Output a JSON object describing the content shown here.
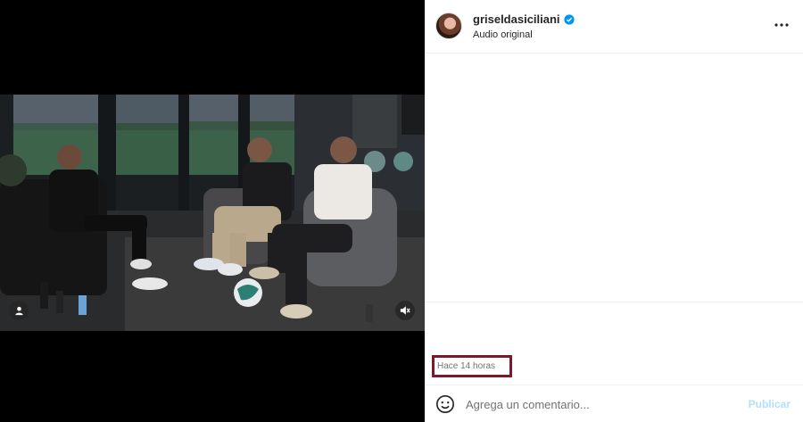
{
  "post": {
    "username": "griseldasiciliani",
    "verified_icon": "verified-badge-icon",
    "audio": "Audio original",
    "timestamp": "Hace 14 horas"
  },
  "media": {
    "tag_icon": "user-tag-icon",
    "mute_icon": "muted-speaker-icon"
  },
  "comment_bar": {
    "placeholder": "Agrega un comentario...",
    "publish_label": "Publicar",
    "emoji_icon": "emoji-icon"
  },
  "colors": {
    "accent_blue": "#0095f6",
    "publish_disabled": "#b2dffc",
    "highlight_box": "#7a1a2c"
  }
}
